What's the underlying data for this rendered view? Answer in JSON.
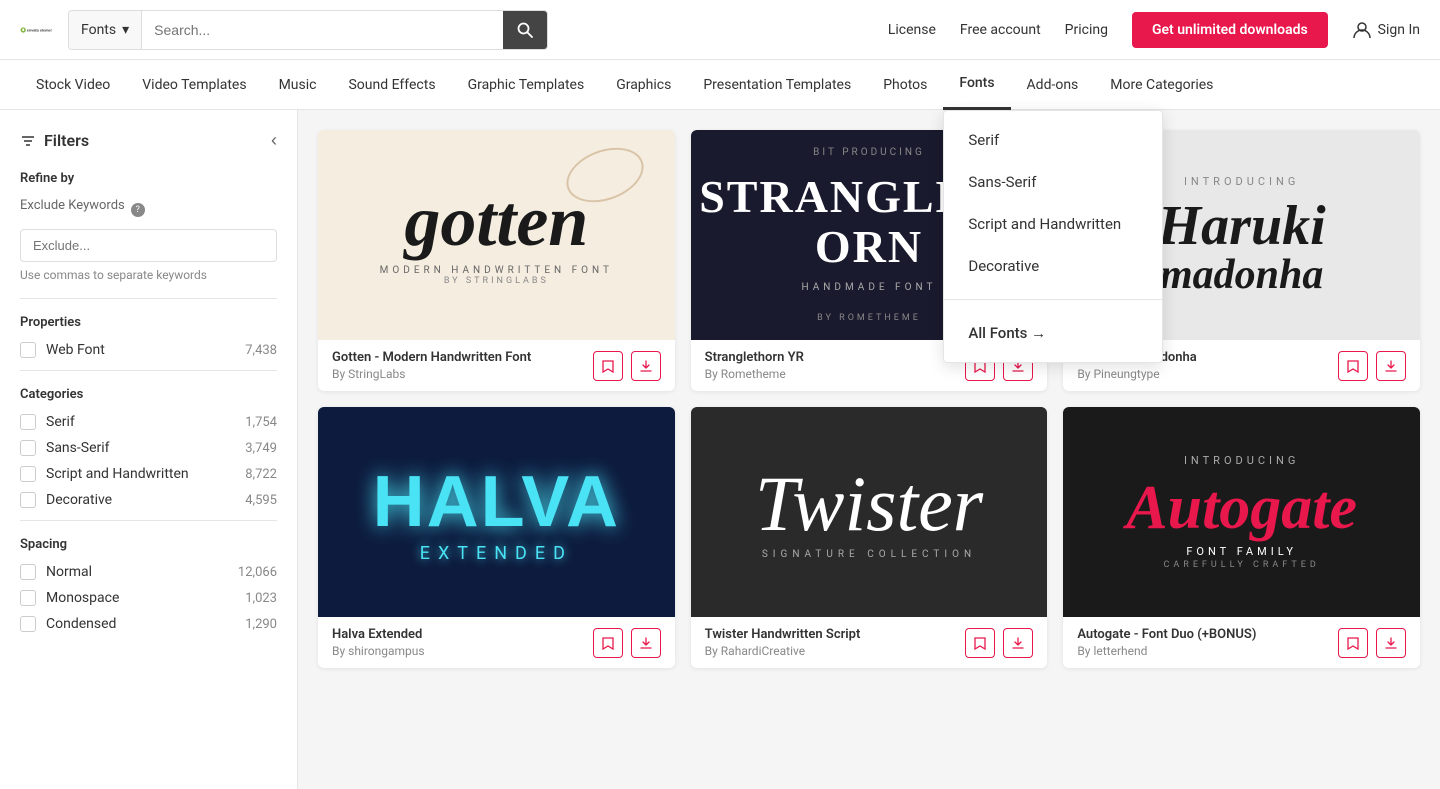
{
  "header": {
    "logo_text": "envato elements",
    "search_placeholder": "Search...",
    "search_category": "Fonts",
    "nav": {
      "license": "License",
      "free_account": "Free account",
      "pricing": "Pricing",
      "cta": "Get unlimited downloads",
      "sign_in": "Sign In"
    }
  },
  "nav_bar": {
    "items": [
      {
        "label": "Stock Video",
        "active": false
      },
      {
        "label": "Video Templates",
        "active": false
      },
      {
        "label": "Music",
        "active": false
      },
      {
        "label": "Sound Effects",
        "active": false
      },
      {
        "label": "Graphic Templates",
        "active": false
      },
      {
        "label": "Graphics",
        "active": false
      },
      {
        "label": "Presentation Templates",
        "active": false
      },
      {
        "label": "Photos",
        "active": false
      },
      {
        "label": "Fonts",
        "active": true
      },
      {
        "label": "Add-ons",
        "active": false
      },
      {
        "label": "More Categories",
        "active": false
      }
    ]
  },
  "fonts_dropdown": {
    "items": [
      {
        "label": "Serif"
      },
      {
        "label": "Sans-Serif"
      },
      {
        "label": "Script and Handwritten"
      },
      {
        "label": "Decorative"
      },
      {
        "label": "All Fonts →",
        "is_all": true
      }
    ]
  },
  "sidebar": {
    "title": "Filters",
    "refine_by": "Refine by",
    "exclude_keywords_label": "Exclude Keywords",
    "exclude_placeholder": "Exclude...",
    "hint": "Use commas to separate keywords",
    "properties_label": "Properties",
    "properties": [
      {
        "label": "Web Font",
        "count": "7,438"
      }
    ],
    "categories_label": "Categories",
    "categories": [
      {
        "label": "Serif",
        "count": "1,754"
      },
      {
        "label": "Sans-Serif",
        "count": "3,749"
      },
      {
        "label": "Script and Handwritten",
        "count": "8,722"
      },
      {
        "label": "Decorative",
        "count": "4,595"
      }
    ],
    "spacing_label": "Spacing",
    "spacing": [
      {
        "label": "Normal",
        "count": "12,066"
      },
      {
        "label": "Monospace",
        "count": "1,023"
      },
      {
        "label": "Condensed",
        "count": "1,290"
      }
    ]
  },
  "grid": {
    "cards": [
      {
        "id": "gotten",
        "title": "Gotten - Modern Handwritten Font",
        "author": "By StringLabs",
        "style": "handwritten-warm"
      },
      {
        "id": "stranglethorn",
        "title": "Stranglethorn YR",
        "author": "By Rometheme",
        "style": "dark-bold"
      },
      {
        "id": "harukia",
        "title": "Harukia Primadonha",
        "author": "By Pineungtype",
        "style": "light-script"
      },
      {
        "id": "halva",
        "title": "Halva Extended",
        "author": "By shirongampus",
        "style": "neon-space"
      },
      {
        "id": "twister",
        "title": "Twister Handwritten Script",
        "author": "By RahardiCreative",
        "style": "dark-handwritten"
      },
      {
        "id": "autogate",
        "title": "Autogate - Font Duo (+BONUS)",
        "author": "By letterhend",
        "style": "dark-retro"
      }
    ]
  }
}
